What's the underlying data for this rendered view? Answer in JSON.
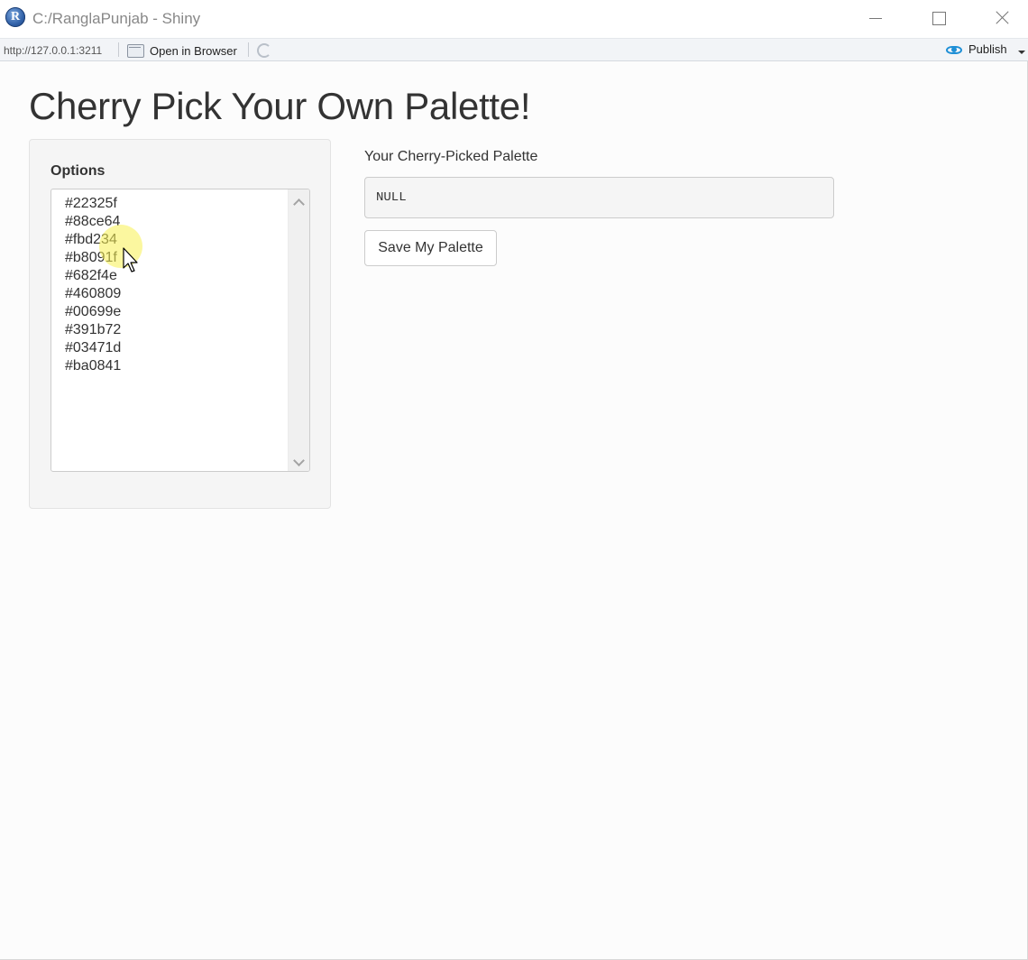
{
  "window": {
    "title": "C:/RanglaPunjab - Shiny",
    "app_icon_letter": "R"
  },
  "toolbar": {
    "url": "http://127.0.0.1:3211",
    "open_in_browser_label": "Open in Browser",
    "publish_label": "Publish"
  },
  "page": {
    "title": "Cherry Pick Your Own Palette!"
  },
  "sidebar": {
    "options_label": "Options",
    "options": [
      "#22325f",
      "#88ce64",
      "#fbd234",
      "#b8091f",
      "#682f4e",
      "#460809",
      "#00699e",
      "#391b72",
      "#03471d",
      "#ba0841"
    ]
  },
  "main": {
    "palette_label": "Your Cherry-Picked Palette",
    "palette_output": "NULL",
    "save_button_label": "Save My Palette"
  },
  "colors": {
    "publish_accent": "#1e8fd6",
    "cursor_highlight": "#f8f050"
  }
}
